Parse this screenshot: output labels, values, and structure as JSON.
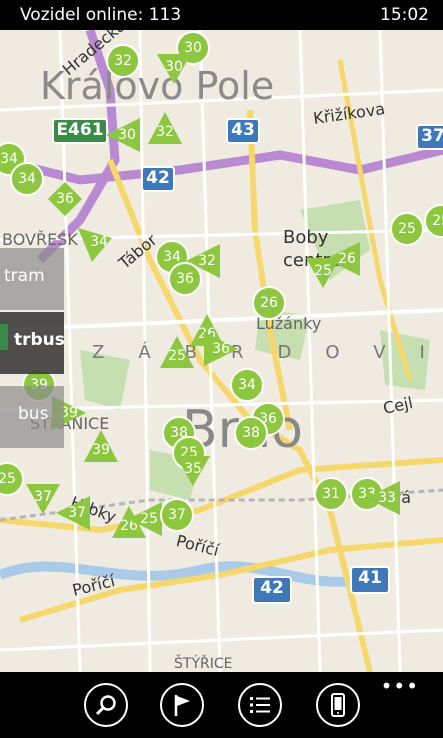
{
  "status": {
    "title": "Vozidel online: 113",
    "time": "15:02"
  },
  "map": {
    "districts": {
      "kralovo_pole": "Královo Pole",
      "brno": "Brno",
      "boby_centrum": "Boby centrum",
      "luzanky": "Lužánky",
      "bohunice": "BOVŘESK",
      "stranice": "STRANICE",
      "styrice": "ŠTÝŘICE",
      "zabrdovice": "ZÁBRDOVICE"
    },
    "street_labels": {
      "hradecka": "Hradecká",
      "krizikova": "Křižíkova",
      "tabor": "Tábor",
      "cejl": "Cejl",
      "porici_1": "Poříčí",
      "porici_2": "Poříčí",
      "kova": "ová",
      "hrbky": "Hrbky"
    },
    "road_shields": [
      {
        "label": "E461",
        "color": "green"
      },
      {
        "label": "43",
        "color": "blue"
      },
      {
        "label": "42",
        "color": "blue"
      },
      {
        "label": "37",
        "color": "blue"
      },
      {
        "label": "42",
        "color": "blue"
      },
      {
        "label": "41",
        "color": "blue"
      }
    ],
    "vehicles": [
      {
        "line": "30",
        "kind": "circle"
      },
      {
        "line": "32",
        "kind": "circle"
      },
      {
        "line": "30",
        "kind": "tri"
      },
      {
        "line": "30",
        "kind": "tri"
      },
      {
        "line": "32",
        "kind": "tri"
      },
      {
        "line": "34",
        "kind": "circle"
      },
      {
        "line": "34",
        "kind": "circle"
      },
      {
        "line": "36",
        "kind": "tri"
      },
      {
        "line": "34",
        "kind": "tri"
      },
      {
        "line": "34",
        "kind": "circle"
      },
      {
        "line": "32",
        "kind": "tri"
      },
      {
        "line": "36",
        "kind": "circle"
      },
      {
        "line": "25",
        "kind": "circle"
      },
      {
        "line": "26",
        "kind": "tri"
      },
      {
        "line": "25",
        "kind": "tri"
      },
      {
        "line": "25",
        "kind": "circle"
      },
      {
        "line": "26",
        "kind": "circle"
      },
      {
        "line": "26",
        "kind": "tri"
      },
      {
        "line": "25",
        "kind": "tri"
      },
      {
        "line": "36",
        "kind": "tri"
      },
      {
        "line": "34",
        "kind": "circle"
      },
      {
        "line": "36",
        "kind": "circle"
      },
      {
        "line": "38",
        "kind": "circle"
      },
      {
        "line": "38",
        "kind": "circle"
      },
      {
        "line": "25",
        "kind": "circle"
      },
      {
        "line": "35",
        "kind": "tri"
      },
      {
        "line": "39",
        "kind": "circle"
      },
      {
        "line": "39",
        "kind": "tri"
      },
      {
        "line": "39",
        "kind": "tri"
      },
      {
        "line": "25",
        "kind": "circle"
      },
      {
        "line": "37",
        "kind": "tri"
      },
      {
        "line": "37",
        "kind": "tri"
      },
      {
        "line": "26",
        "kind": "tri"
      },
      {
        "line": "25",
        "kind": "tri"
      },
      {
        "line": "37",
        "kind": "circle"
      },
      {
        "line": "31",
        "kind": "circle"
      },
      {
        "line": "33",
        "kind": "circle"
      },
      {
        "line": "33",
        "kind": "tri"
      }
    ],
    "filters": [
      {
        "label": "tram",
        "active": false
      },
      {
        "label": "trbus",
        "active": true
      },
      {
        "label": "bus",
        "active": false
      }
    ]
  },
  "appbar": {
    "buttons": [
      {
        "name": "search",
        "icon": "search-icon"
      },
      {
        "name": "flag",
        "icon": "flag-icon"
      },
      {
        "name": "list",
        "icon": "list-icon"
      },
      {
        "name": "phone",
        "icon": "phone-icon"
      }
    ],
    "more": "•••"
  }
}
